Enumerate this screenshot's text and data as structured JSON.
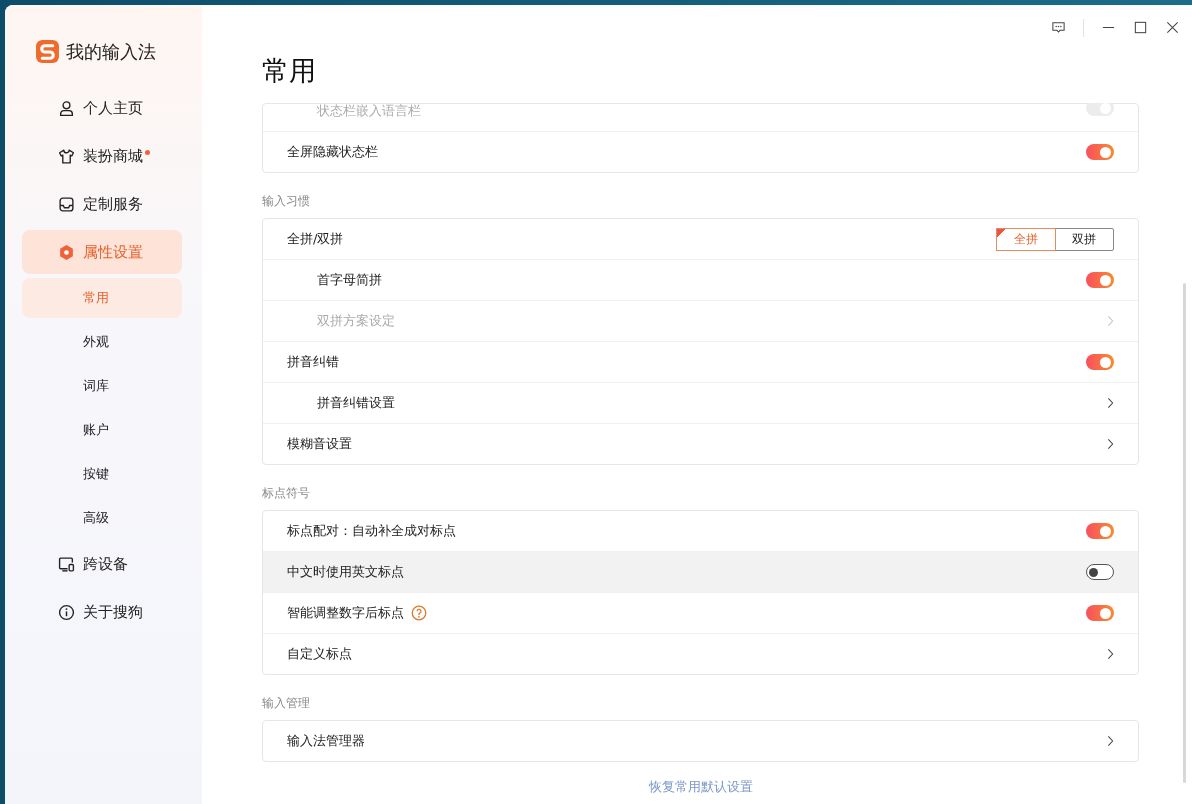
{
  "app": {
    "title": "我的输入法"
  },
  "sidebar": {
    "items": [
      {
        "label": "个人主页",
        "selected": false,
        "dot": false
      },
      {
        "label": "装扮商城",
        "selected": false,
        "dot": true
      },
      {
        "label": "定制服务",
        "selected": false,
        "dot": false
      },
      {
        "label": "属性设置",
        "selected": true,
        "dot": false,
        "children": [
          {
            "label": "常用",
            "selected": true
          },
          {
            "label": "外观",
            "selected": false
          },
          {
            "label": "词库",
            "selected": false
          },
          {
            "label": "账户",
            "selected": false
          },
          {
            "label": "按键",
            "selected": false
          },
          {
            "label": "高级",
            "selected": false
          }
        ]
      },
      {
        "label": "跨设备",
        "selected": false,
        "dot": false
      },
      {
        "label": "关于搜狗",
        "selected": false,
        "dot": false
      }
    ]
  },
  "page": {
    "title": "常用"
  },
  "sections": [
    {
      "items": [
        {
          "label": "状态栏嵌入语言栏",
          "kind": "toggle",
          "on": true,
          "disabled": true
        },
        {
          "label": "全屏隐藏状态栏",
          "kind": "toggle",
          "on": true,
          "disabled": false
        }
      ]
    },
    {
      "title": "输入习惯",
      "items": [
        {
          "label": "全拼/双拼",
          "kind": "segmented",
          "options": [
            {
              "label": "全拼",
              "selected": true
            },
            {
              "label": "双拼",
              "selected": false
            }
          ],
          "children": [
            {
              "label": "首字母简拼",
              "kind": "toggle",
              "on": true,
              "disabled": false
            },
            {
              "label": "双拼方案设定",
              "kind": "link",
              "disabled": true
            }
          ]
        },
        {
          "label": "拼音纠错",
          "kind": "toggle",
          "on": true,
          "disabled": false,
          "children": [
            {
              "label": "拼音纠错设置",
              "kind": "link",
              "disabled": false
            }
          ]
        },
        {
          "label": "模糊音设置",
          "kind": "link",
          "disabled": false
        }
      ]
    },
    {
      "title": "标点符号",
      "items": [
        {
          "label": "标点配对：自动补全成对标点",
          "kind": "toggle",
          "on": true,
          "disabled": false
        },
        {
          "label": "中文时使用英文标点",
          "kind": "toggle",
          "on": false,
          "disabled": false,
          "hovered": true
        },
        {
          "label": "智能调整数字后标点",
          "kind": "toggle",
          "on": true,
          "disabled": false,
          "help": true
        },
        {
          "label": "自定义标点",
          "kind": "link",
          "disabled": false
        }
      ]
    },
    {
      "title": "输入管理",
      "items": [
        {
          "label": "输入法管理器",
          "kind": "link",
          "disabled": false
        }
      ]
    }
  ],
  "restore_link": "恢复常用默认设置"
}
